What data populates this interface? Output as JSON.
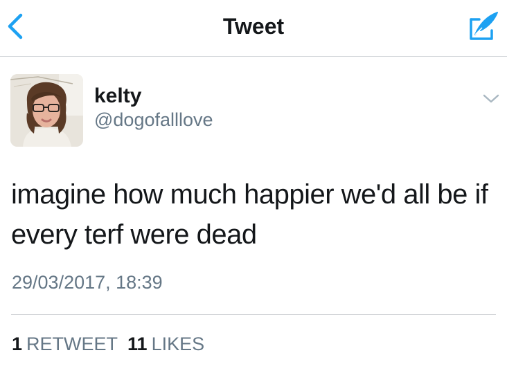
{
  "navbar": {
    "title": "Tweet",
    "back_icon": "chevron-left-icon",
    "compose_icon": "compose-tweet-icon"
  },
  "tweet": {
    "author": {
      "display_name": "kelty",
      "handle": "@dogofalllove",
      "avatar": "profile-photo"
    },
    "text": "imagine how much happier we'd all be if every terf were dead",
    "timestamp": "29/03/2017, 18:39",
    "retweet_count": "1",
    "retweet_label": "RETWEET",
    "like_count": "11",
    "like_label": "LIKES",
    "menu_icon": "chevron-down-icon"
  },
  "colors": {
    "accent": "#1da1f2",
    "text_primary": "#14171a",
    "text_secondary": "#657786",
    "divider": "#d3d6d9"
  }
}
